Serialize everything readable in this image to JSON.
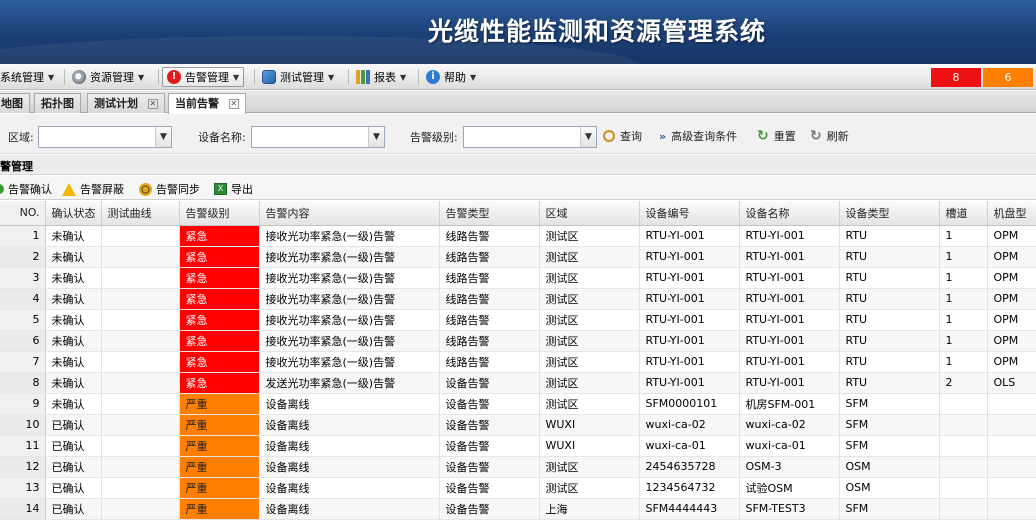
{
  "header": {
    "title": "光缆性能监测和资源管理系统"
  },
  "menu": {
    "items": [
      {
        "label": "系统管理"
      },
      {
        "label": "资源管理"
      },
      {
        "label": "告警管理"
      },
      {
        "label": "测试管理"
      },
      {
        "label": "报表"
      },
      {
        "label": "帮助"
      }
    ],
    "alarm_counts": [
      {
        "value": "8",
        "color": "#ee1111"
      },
      {
        "value": "6",
        "color": "#ff8000"
      }
    ]
  },
  "tabs": [
    {
      "label": "地图"
    },
    {
      "label": "拓扑图"
    },
    {
      "label": "测试计划"
    },
    {
      "label": "当前告警"
    }
  ],
  "filter": {
    "region_label": "区域:",
    "device_label": "设备名称:",
    "level_label": "告警级别:",
    "query_label": "查询",
    "advanced_label": "高级查询条件",
    "reset_label": "重置",
    "refresh_label": "刷新"
  },
  "panel": {
    "title": "警管理"
  },
  "actions": [
    {
      "label": "告警确认"
    },
    {
      "label": "告警屏蔽"
    },
    {
      "label": "告警同步"
    },
    {
      "label": "导出"
    }
  ],
  "table": {
    "columns": [
      "NO.",
      "确认状态",
      "测试曲线",
      "告警级别",
      "告警内容",
      "告警类型",
      "区域",
      "设备编号",
      "设备名称",
      "设备类型",
      "槽道",
      "机盘型"
    ],
    "level_colors": {
      "紧急": "#ff0000",
      "严重": "#ff7f00"
    },
    "rows": [
      [
        "1",
        "未确认",
        "",
        "紧急",
        "接收光功率紧急(一级)告警",
        "线路告警",
        "测试区",
        "RTU-YI-001",
        "RTU-YI-001",
        "RTU",
        "1",
        "OPM"
      ],
      [
        "2",
        "未确认",
        "",
        "紧急",
        "接收光功率紧急(一级)告警",
        "线路告警",
        "测试区",
        "RTU-YI-001",
        "RTU-YI-001",
        "RTU",
        "1",
        "OPM"
      ],
      [
        "3",
        "未确认",
        "",
        "紧急",
        "接收光功率紧急(一级)告警",
        "线路告警",
        "测试区",
        "RTU-YI-001",
        "RTU-YI-001",
        "RTU",
        "1",
        "OPM"
      ],
      [
        "4",
        "未确认",
        "",
        "紧急",
        "接收光功率紧急(一级)告警",
        "线路告警",
        "测试区",
        "RTU-YI-001",
        "RTU-YI-001",
        "RTU",
        "1",
        "OPM"
      ],
      [
        "5",
        "未确认",
        "",
        "紧急",
        "接收光功率紧急(一级)告警",
        "线路告警",
        "测试区",
        "RTU-YI-001",
        "RTU-YI-001",
        "RTU",
        "1",
        "OPM"
      ],
      [
        "6",
        "未确认",
        "",
        "紧急",
        "接收光功率紧急(一级)告警",
        "线路告警",
        "测试区",
        "RTU-YI-001",
        "RTU-YI-001",
        "RTU",
        "1",
        "OPM"
      ],
      [
        "7",
        "未确认",
        "",
        "紧急",
        "接收光功率紧急(一级)告警",
        "线路告警",
        "测试区",
        "RTU-YI-001",
        "RTU-YI-001",
        "RTU",
        "1",
        "OPM"
      ],
      [
        "8",
        "未确认",
        "",
        "紧急",
        "发送光功率紧急(一级)告警",
        "设备告警",
        "测试区",
        "RTU-YI-001",
        "RTU-YI-001",
        "RTU",
        "2",
        "OLS"
      ],
      [
        "9",
        "未确认",
        "",
        "严重",
        "设备离线",
        "设备告警",
        "测试区",
        "SFM0000101",
        "机房SFM-001",
        "SFM",
        "",
        ""
      ],
      [
        "10",
        "已确认",
        "",
        "严重",
        "设备离线",
        "设备告警",
        "WUXI",
        "wuxi-ca-02",
        "wuxi-ca-02",
        "SFM",
        "",
        ""
      ],
      [
        "11",
        "已确认",
        "",
        "严重",
        "设备离线",
        "设备告警",
        "WUXI",
        "wuxi-ca-01",
        "wuxi-ca-01",
        "SFM",
        "",
        ""
      ],
      [
        "12",
        "已确认",
        "",
        "严重",
        "设备离线",
        "设备告警",
        "测试区",
        "2454635728",
        "OSM-3",
        "OSM",
        "",
        ""
      ],
      [
        "13",
        "已确认",
        "",
        "严重",
        "设备离线",
        "设备告警",
        "测试区",
        "1234564732",
        "试验OSM",
        "OSM",
        "",
        ""
      ],
      [
        "14",
        "已确认",
        "",
        "严重",
        "设备离线",
        "设备告警",
        "上海",
        "SFM4444443",
        "SFM-TEST3",
        "SFM",
        "",
        ""
      ]
    ]
  }
}
